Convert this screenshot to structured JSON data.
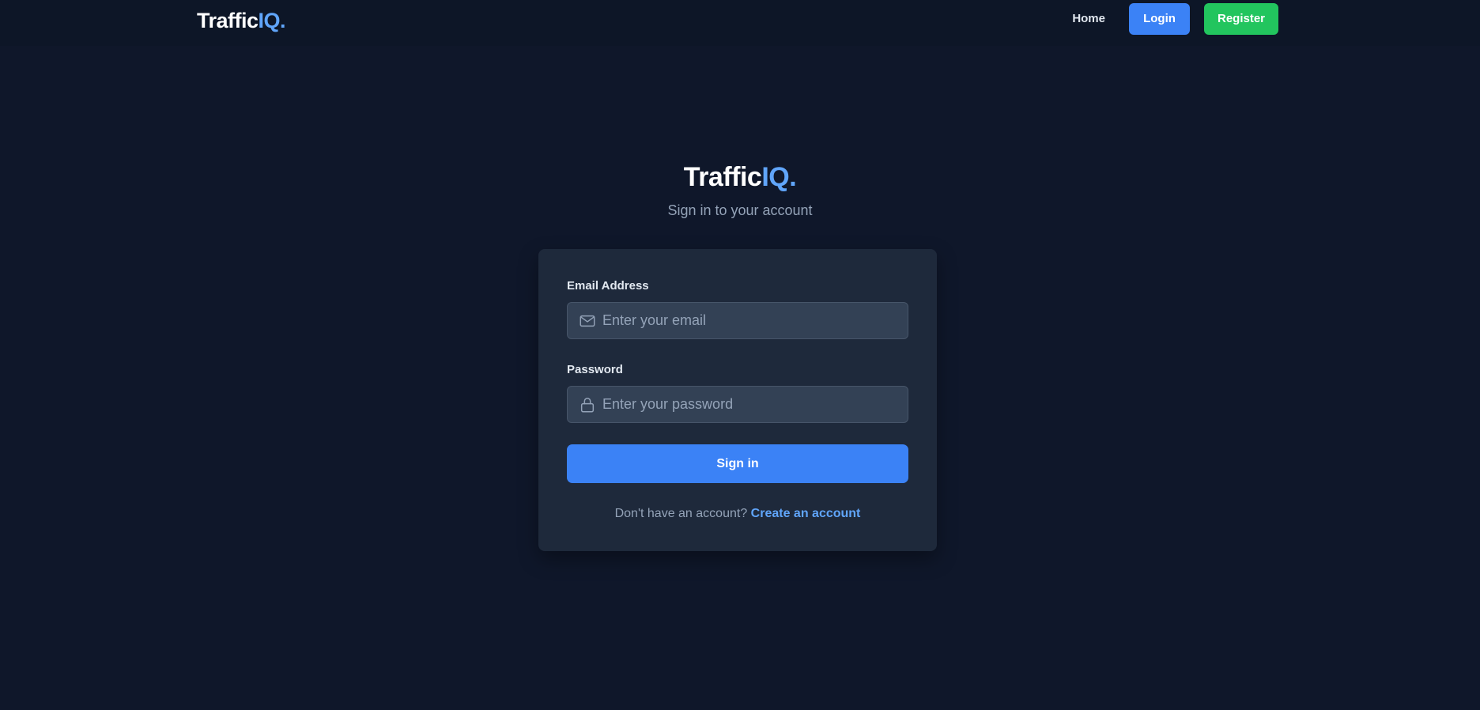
{
  "navbar": {
    "logo": {
      "main": "Traffic",
      "accent": "IQ."
    },
    "home_label": "Home",
    "login_label": "Login",
    "register_label": "Register"
  },
  "hero": {
    "logo": {
      "main": "Traffic",
      "accent": "IQ."
    },
    "subtitle": "Sign in to your account"
  },
  "form": {
    "email": {
      "label": "Email Address",
      "placeholder": "Enter your email",
      "value": "",
      "icon": "mail-icon"
    },
    "password": {
      "label": "Password",
      "placeholder": "Enter your password",
      "value": "",
      "icon": "lock-icon"
    },
    "submit_label": "Sign in",
    "footer_prompt": "Don't have an account?",
    "footer_link": "Create an account"
  },
  "colors": {
    "background": "#0f172a",
    "navbar": "#0d1627",
    "card": "#1e293b",
    "input": "#334155",
    "primary": "#3b82f6",
    "success": "#22c55e",
    "accent_text": "#60a5fa"
  }
}
